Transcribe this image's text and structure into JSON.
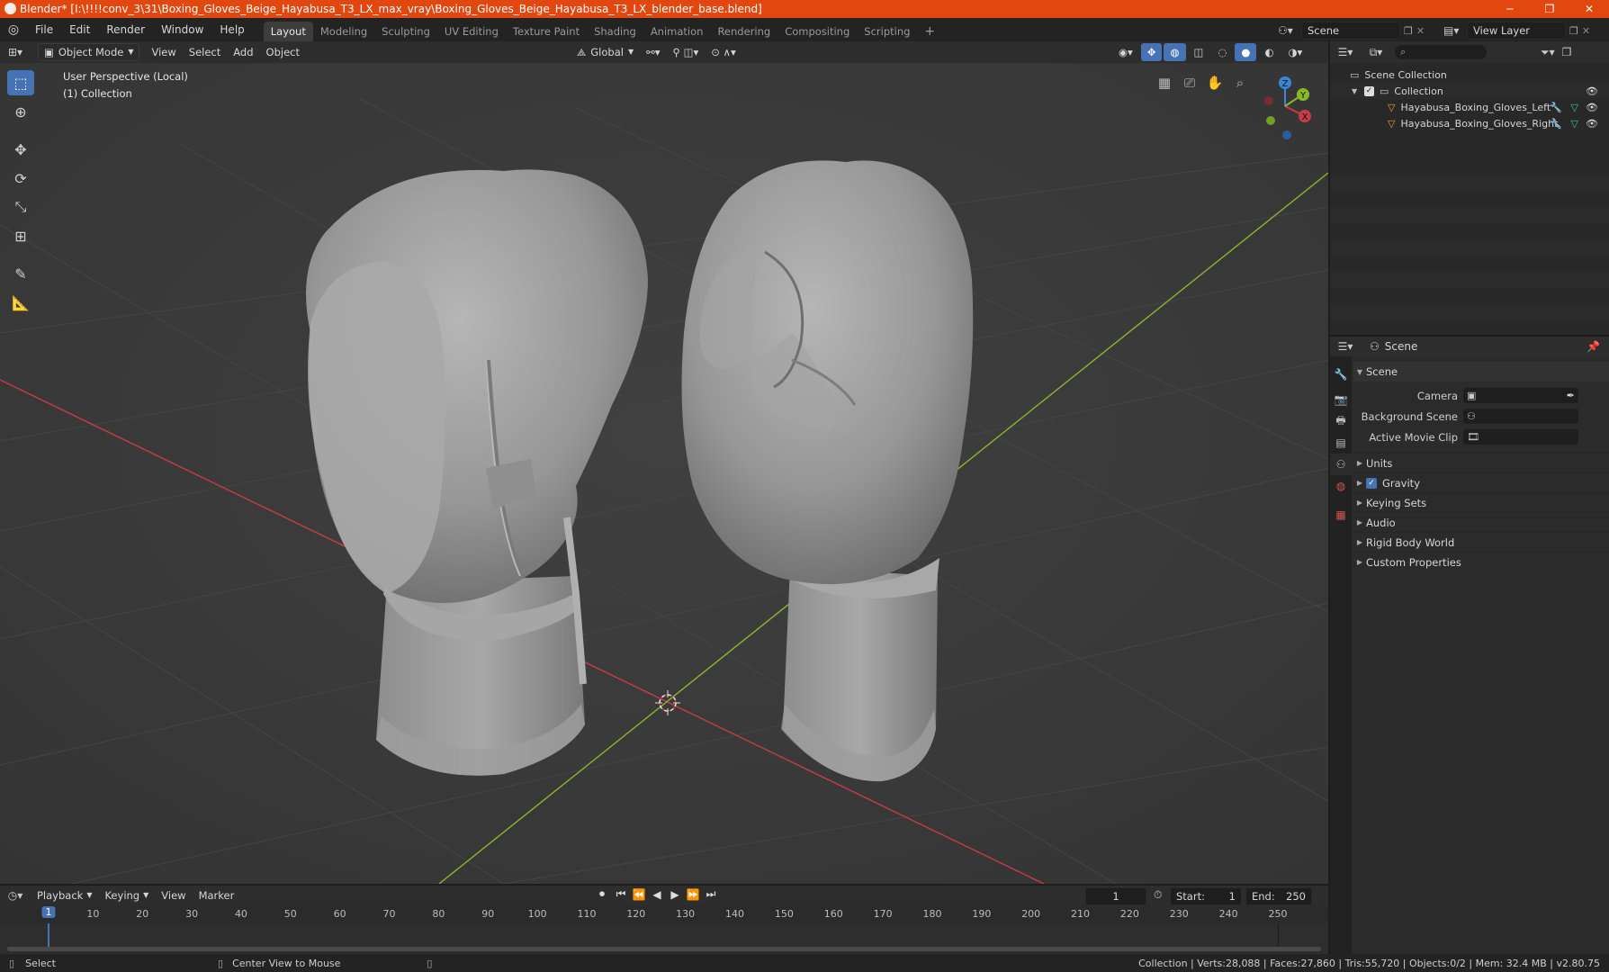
{
  "window": {
    "title": "Blender* [I:\\!!!!conv_3\\31\\Boxing_Gloves_Beige_Hayabusa_T3_LX_max_vray\\Boxing_Gloves_Beige_Hayabusa_T3_LX_blender_base.blend]",
    "min_label": "─",
    "restore_label": "❐",
    "close_label": "✕"
  },
  "menu": {
    "items": [
      "File",
      "Edit",
      "Render",
      "Window",
      "Help"
    ]
  },
  "workspaces": [
    "Layout",
    "Modeling",
    "Sculpting",
    "UV Editing",
    "Texture Paint",
    "Shading",
    "Animation",
    "Rendering",
    "Compositing",
    "Scripting"
  ],
  "workspace_add": "+",
  "scene_selector": {
    "value": "Scene"
  },
  "view_layer_selector": {
    "value": "View Layer"
  },
  "viewport_header": {
    "mode": "Object Mode",
    "menus": [
      "View",
      "Select",
      "Add",
      "Object"
    ],
    "orientation": "Global"
  },
  "viewport": {
    "perspective_label": "User Perspective (Local)",
    "collection_label": "(1) Collection",
    "gizmo_axes": {
      "x": "X",
      "y": "Y",
      "z": "Z"
    }
  },
  "outliner": {
    "root": "Scene Collection",
    "collection": "Collection",
    "objects": [
      "Hayabusa_Boxing_Gloves_Left",
      "Hayabusa_Boxing_Gloves_Right"
    ]
  },
  "properties": {
    "context": "Scene",
    "panel_title": "Scene",
    "fields": [
      {
        "label": "Camera",
        "value": ""
      },
      {
        "label": "Background Scene",
        "value": ""
      },
      {
        "label": "Active Movie Clip",
        "value": ""
      }
    ],
    "sections": [
      {
        "label": "Units",
        "checkbox": false
      },
      {
        "label": "Gravity",
        "checkbox": true
      },
      {
        "label": "Keying Sets",
        "checkbox": false
      },
      {
        "label": "Audio",
        "checkbox": false
      },
      {
        "label": "Rigid Body World",
        "checkbox": false
      },
      {
        "label": "Custom Properties",
        "checkbox": false
      }
    ]
  },
  "timeline": {
    "menus": [
      "Playback",
      "Keying",
      "View",
      "Marker"
    ],
    "current_frame": "1",
    "start_label": "Start:",
    "start": "1",
    "end_label": "End:",
    "end": "250",
    "ruler": [
      "1",
      "10",
      "20",
      "30",
      "40",
      "50",
      "60",
      "70",
      "80",
      "90",
      "100",
      "110",
      "120",
      "130",
      "140",
      "150",
      "160",
      "170",
      "180",
      "190",
      "200",
      "210",
      "220",
      "230",
      "240",
      "250"
    ]
  },
  "statusbar": {
    "left_action": "Select",
    "middle_action": "Center View to Mouse",
    "stats": "Collection | Verts:28,088 | Faces:27,860 | Tris:55,720 | Objects:0/2 | Mem: 32.4 MB | v2.80.75"
  },
  "colors": {
    "titlebar": "#e2470f",
    "accent": "#4772b3",
    "x_axis": "#c83c46",
    "y_axis": "#8ab82a",
    "z_axis": "#3b84d8"
  }
}
